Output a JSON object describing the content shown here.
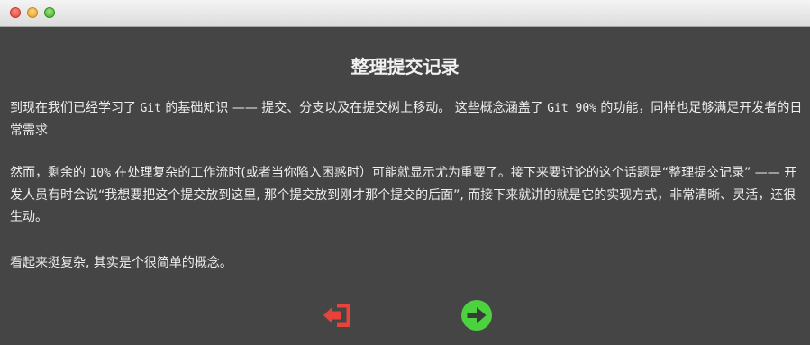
{
  "dialog": {
    "title": "整理提交记录",
    "p1_a": "到现在我们已经学习了 ",
    "p1_git": "Git",
    "p1_b": " 的基础知识 —— 提交、分支以及在提交树上移动。 这些概念涵盖了 ",
    "p1_git90": "Git 90%",
    "p1_c": " 的功能，同样也足够满足开发者的日常需求",
    "p2_a": "然而，剩余的 ",
    "p2_pct": "10%",
    "p2_b": " 在处理复杂的工作流时(或者当你陷入困惑时）可能就显示尤为重要了。接下来要讨论的这个话题是“整理提交记录” —— 开发人员有时会说“我想要把这个提交放到这里, 那个提交放到刚才那个提交的后面”, 而接下来就讲的就是它的实现方式，非常清晰、灵活，还很生动。",
    "p3": "看起来挺复杂, 其实是个很简单的概念。"
  },
  "buttons": {
    "exit_icon": "exit-icon",
    "next_icon": "arrow-right-circle-icon"
  },
  "colors": {
    "exit": "#e8423a",
    "next": "#4cd13f",
    "background": "#454545"
  }
}
